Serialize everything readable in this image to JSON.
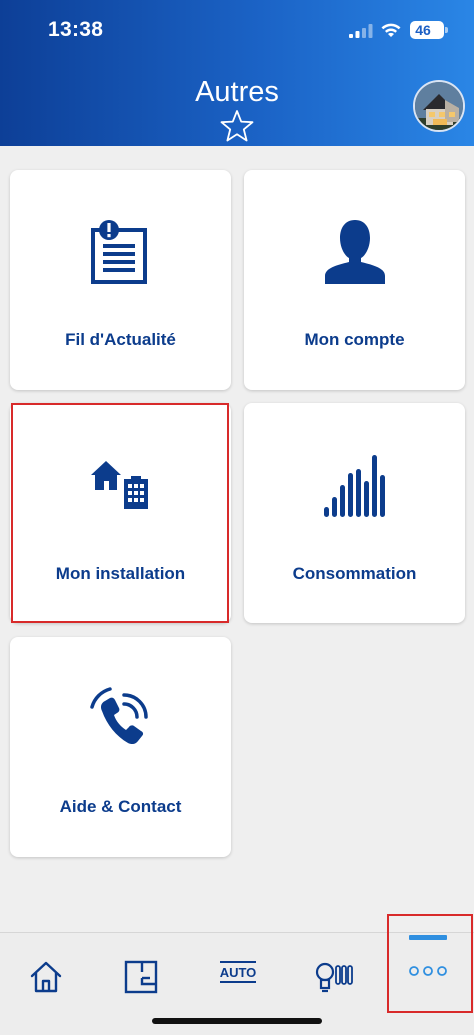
{
  "status_bar": {
    "time": "13:38",
    "battery": "46"
  },
  "header": {
    "title": "Autres"
  },
  "tiles": [
    {
      "label": "Fil d'Actualité",
      "icon": "news-feed-icon"
    },
    {
      "label": "Mon compte",
      "icon": "user-account-icon"
    },
    {
      "label": "Mon installation",
      "icon": "house-building-icon"
    },
    {
      "label": "Consommation",
      "icon": "consumption-bars-icon"
    },
    {
      "label": "Aide & Contact",
      "icon": "phone-call-icon"
    }
  ],
  "bottom_nav": {
    "items": [
      {
        "icon": "home-icon"
      },
      {
        "icon": "floor-plan-icon"
      },
      {
        "icon": "auto-icon",
        "label": "AUTO"
      },
      {
        "icon": "light-bulb-radiator-icon"
      },
      {
        "icon": "more-dots-icon",
        "active": true
      }
    ]
  },
  "colors": {
    "header_start": "#0d3f97",
    "header_end": "#2a86e6",
    "primary": "#0c3c8c",
    "accent_active": "#2f8fe0",
    "highlight": "#d82a2a"
  }
}
